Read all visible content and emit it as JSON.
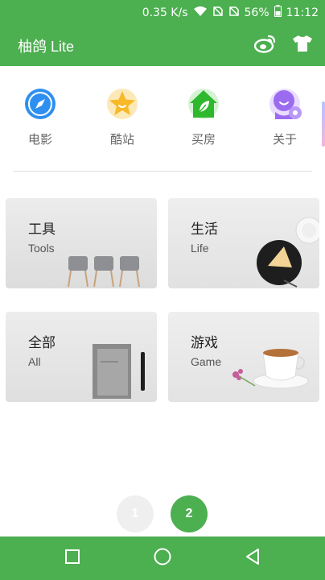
{
  "status_bar": {
    "speed": "0.35 K/s",
    "battery": "56%",
    "time": "11:12"
  },
  "app_bar": {
    "title": "柚鸽 Lite",
    "weibo_icon": "weibo-icon",
    "shirt_icon": "shirt-icon"
  },
  "shortcuts": [
    {
      "label": "电影",
      "icon": "compass-icon",
      "color": "#2f8ff0"
    },
    {
      "label": "酷站",
      "icon": "star-icon",
      "color": "#f7b928"
    },
    {
      "label": "买房",
      "icon": "house-leaf-icon",
      "color": "#2eb82e"
    },
    {
      "label": "关于",
      "icon": "profile-gear-icon",
      "color": "#9b6cf0"
    }
  ],
  "cards": [
    {
      "cn": "工具",
      "en": "Tools"
    },
    {
      "cn": "生活",
      "en": "Life"
    },
    {
      "cn": "全部",
      "en": "All"
    },
    {
      "cn": "游戏",
      "en": "Game"
    }
  ],
  "pager": {
    "page1": "1",
    "page2": "2",
    "active": 2
  },
  "colors": {
    "primary": "#4caf50",
    "card_bg": "#e8e8e8",
    "label_gray": "#666666"
  }
}
